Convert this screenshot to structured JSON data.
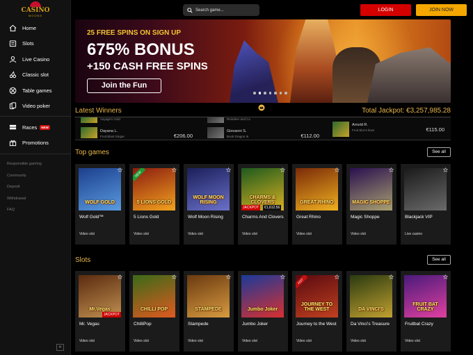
{
  "logo": {
    "word": "CASINO",
    "sub": "MOONS"
  },
  "sidebar": {
    "items": [
      {
        "label": "Home",
        "icon": "home-icon"
      },
      {
        "label": "Slots",
        "icon": "slot-machine-icon"
      },
      {
        "label": "Live Casino",
        "icon": "live-dealer-icon"
      },
      {
        "label": "Classic slot",
        "icon": "cherry-icon"
      },
      {
        "label": "Table games",
        "icon": "roulette-icon"
      },
      {
        "label": "Video poker",
        "icon": "cards-icon"
      }
    ],
    "extra_items": [
      {
        "label": "Races",
        "icon": "flag-icon",
        "badge": "NEW"
      },
      {
        "label": "Promotions",
        "icon": "gift-icon"
      }
    ],
    "footer_links": [
      "Responsible gaming",
      "Community",
      "Deposit",
      "Withdrawal",
      "FAQ"
    ],
    "collapse_label": "«"
  },
  "header": {
    "search_placeholder": "Search game...",
    "login_label": "LOGIN",
    "join_label": "JOIN NOW"
  },
  "banner": {
    "line1": "25 FREE SPINS ON SIGN UP",
    "line2": "675% BONUS",
    "line3": "+150 CASH FREE SPINS",
    "cta": "Join the Fun",
    "slides": 7,
    "active_slide": 1
  },
  "winners": {
    "title": "Latest Winners",
    "jackpot_label": "Total Jackpot: €3,257,985.28",
    "items": [
      {
        "prev_game": "Voyage's Gold",
        "name": "Dayana L.",
        "game": "Fruit Blast Ginger",
        "amount": "€206.00"
      },
      {
        "prev_game": "Reindeer and Co",
        "name": "Giovanni S.",
        "game": "Book Dragon III",
        "amount": "€112.00"
      },
      {
        "prev_game": "",
        "name": "Arnold R.",
        "game": "Fruit Slot 5 lines",
        "amount": "€115.00"
      }
    ]
  },
  "top_games": {
    "title": "Top games",
    "see_all": "See all",
    "cards": [
      {
        "name": "Wolf Gold™",
        "type": "Video slot",
        "art_title": "WOLF GOLD",
        "bg1": "#1c3f8c",
        "bg2": "#5a9be0"
      },
      {
        "name": "5 Lions Gold",
        "type": "Video slot",
        "art_title": "5 LIONS GOLD",
        "bg1": "#8c1d10",
        "bg2": "#f2a21e",
        "ribbon": "NEW"
      },
      {
        "name": "Wolf Moon Rising",
        "type": "Video slot",
        "art_title": "WOLF MOON RISING",
        "bg1": "#1a1f5a",
        "bg2": "#6a70c8"
      },
      {
        "name": "Charms And Clovers",
        "type": "Video slot",
        "art_title": "CHARMS & CLOVERS",
        "bg1": "#1e5a1e",
        "bg2": "#d8b020",
        "jackpot": "JACKPOT",
        "jackpot_value": "€1,612.56"
      },
      {
        "name": "Great Rhino",
        "type": "Video slot",
        "art_title": "GREAT RHINO",
        "bg1": "#7a2a08",
        "bg2": "#f0b020"
      },
      {
        "name": "Magic Shoppe",
        "type": "Video slot",
        "art_title": "MAGIC SHOPPE",
        "bg1": "#2a1050",
        "bg2": "#a8a070"
      },
      {
        "name": "Blackjack VIP",
        "type": "Live casino",
        "art_title": "",
        "bg1": "#1a1a1a",
        "bg2": "#6a6a6a"
      }
    ]
  },
  "slots": {
    "title": "Slots",
    "see_all": "See all",
    "cards": [
      {
        "name": "Mr. Vegas",
        "type": "Video slot",
        "art_title": "Mr.Vegas",
        "bg1": "#5a2a10",
        "bg2": "#c09050",
        "jackpot": "JACKPOT"
      },
      {
        "name": "ChilliPop",
        "type": "Video slot",
        "art_title": "CHILLI POP",
        "bg1": "#3a6a18",
        "bg2": "#e05a20"
      },
      {
        "name": "Stampede",
        "type": "Video slot",
        "art_title": "STAMPEDE",
        "bg1": "#6a3a10",
        "bg2": "#d89a40"
      },
      {
        "name": "Jumbo Joker",
        "type": "Video slot",
        "art_title": "Jumbo Joker",
        "bg1": "#1a3a9a",
        "bg2": "#d83030"
      },
      {
        "name": "Journey to the West",
        "type": "Video slot",
        "art_title": "JOURNEY TO THE WEST",
        "bg1": "#5a0a10",
        "bg2": "#c04020",
        "ribbon": "HOT"
      },
      {
        "name": "Da Vinci's Treasure",
        "type": "Video slot",
        "art_title": "DA VINCI'S",
        "bg1": "#2a3a10",
        "bg2": "#c0a030"
      },
      {
        "name": "Fruitbat Crazy",
        "type": "Video slot",
        "art_title": "FRUIT BAT CRAZY",
        "bg1": "#4a1a7a",
        "bg2": "#e040a0"
      }
    ]
  }
}
